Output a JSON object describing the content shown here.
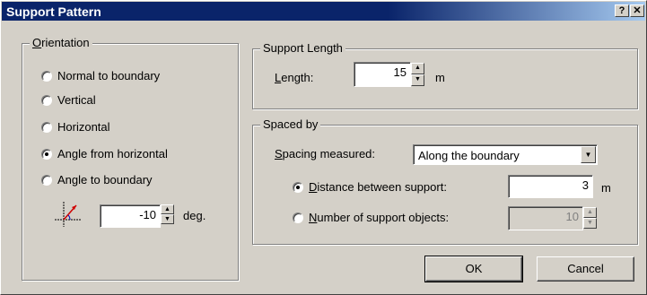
{
  "window": {
    "title": "Support Pattern",
    "help_button": "?",
    "close_button": "✕"
  },
  "orientation": {
    "legend_u": "O",
    "legend_rest": "rientation",
    "options": [
      {
        "label": "Normal to boundary",
        "checked": false
      },
      {
        "label": "Vertical",
        "checked": false
      },
      {
        "label": "Horizontal",
        "checked": false
      },
      {
        "label": "Angle from horizontal",
        "checked": true
      },
      {
        "label": "Angle to boundary",
        "checked": false
      }
    ],
    "angle_value": "-10",
    "angle_unit": "deg."
  },
  "support_length": {
    "legend": "Support Length",
    "label_u": "L",
    "label_rest": "ength:",
    "value": "15",
    "unit": "m"
  },
  "spaced_by": {
    "legend": "Spaced by",
    "spacing_label_u": "S",
    "spacing_label_rest": "pacing measured:",
    "spacing_value": "Along the boundary",
    "distance_u": "D",
    "distance_rest": "istance between support:",
    "distance_checked": true,
    "distance_value": "3",
    "distance_unit": "m",
    "number_u": "N",
    "number_rest": "umber of support objects:",
    "number_checked": false,
    "number_value": "10"
  },
  "buttons": {
    "ok": "OK",
    "cancel": "Cancel"
  },
  "icons": {
    "angle": "angle-diagram-icon",
    "spin_up": "▲",
    "spin_down": "▼",
    "dropdown": "▼"
  }
}
